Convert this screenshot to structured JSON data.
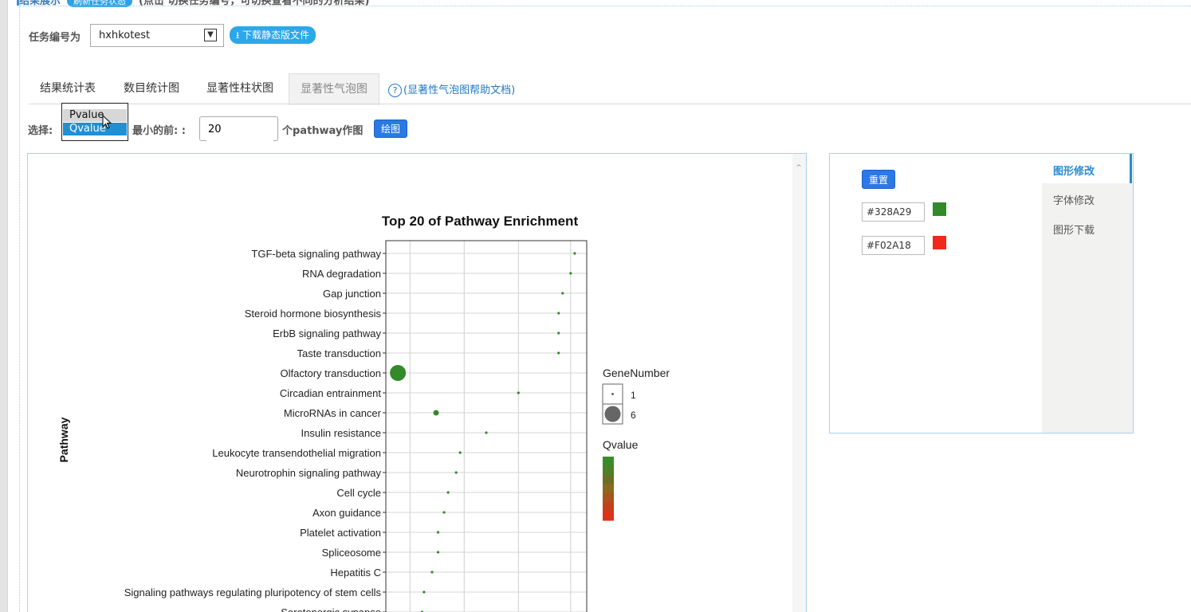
{
  "top": {
    "title": "结果展示",
    "refresh_label": "刷新任务状态",
    "hint": "(点击 切换任务编号，可切换查看不同的分析结果)"
  },
  "task": {
    "label": "任务编号为",
    "value": "hxhkotest",
    "download_label": "下载静态版文件"
  },
  "tabs": [
    {
      "label": "结果统计表"
    },
    {
      "label": "数目统计图"
    },
    {
      "label": "显著性柱状图"
    },
    {
      "label": "显著性气泡图",
      "active": true
    }
  ],
  "help_link": "(显著性气泡图帮助文档)",
  "controls": {
    "select_label": "选择:",
    "options": [
      "Pvalue",
      "Qvalue"
    ],
    "selected": "Qvalue",
    "min_label": "最小的前: :",
    "top_n": "20",
    "after_label": "个pathway作图",
    "draw_label": "绘图"
  },
  "side": {
    "reset_label": "重置",
    "color_low": "#328A29",
    "color_high": "#F02A18",
    "menu": [
      "图形修改",
      "字体修改",
      "图形下载"
    ],
    "menu_active": "图形修改"
  },
  "chart_data": {
    "type": "scatter",
    "title": "Top 20 of Pathway Enrichment",
    "ylabel": "Pathway",
    "categories": [
      "TGF-beta signaling pathway",
      "RNA degradation",
      "Gap junction",
      "Steroid hormone biosynthesis",
      "ErbB signaling pathway",
      "Taste transduction",
      "Olfactory transduction",
      "Circadian entrainment",
      "MicroRNAs in cancer",
      "Insulin resistance",
      "Leukocyte transendothelial migration",
      "Neurotrophin signaling pathway",
      "Cell cycle",
      "Axon guidance",
      "Platelet activation",
      "Spliceosome",
      "Hepatitis C",
      "Signaling pathways regulating pluripotency of stem cells",
      "Serotonergic synapse"
    ],
    "x_fraction": [
      0.94,
      0.92,
      0.88,
      0.86,
      0.86,
      0.86,
      0.06,
      0.66,
      0.25,
      0.5,
      0.37,
      0.35,
      0.31,
      0.29,
      0.26,
      0.26,
      0.23,
      0.19,
      0.18
    ],
    "gene_number": [
      1,
      1,
      1,
      1,
      1,
      1,
      6,
      1,
      2,
      1,
      1,
      1,
      1,
      1,
      1,
      1,
      1,
      1,
      1
    ],
    "point_color": "#328A29",
    "legend": {
      "size_title": "GeneNumber",
      "size_entries": [
        "1",
        "6"
      ],
      "color_title": "Qvalue",
      "color_stops": [
        "#3b8a2a",
        "#4f7f28",
        "#6a6f24",
        "#8b6a1e",
        "#a8541c",
        "#c43f1a",
        "#dc3318"
      ]
    }
  }
}
